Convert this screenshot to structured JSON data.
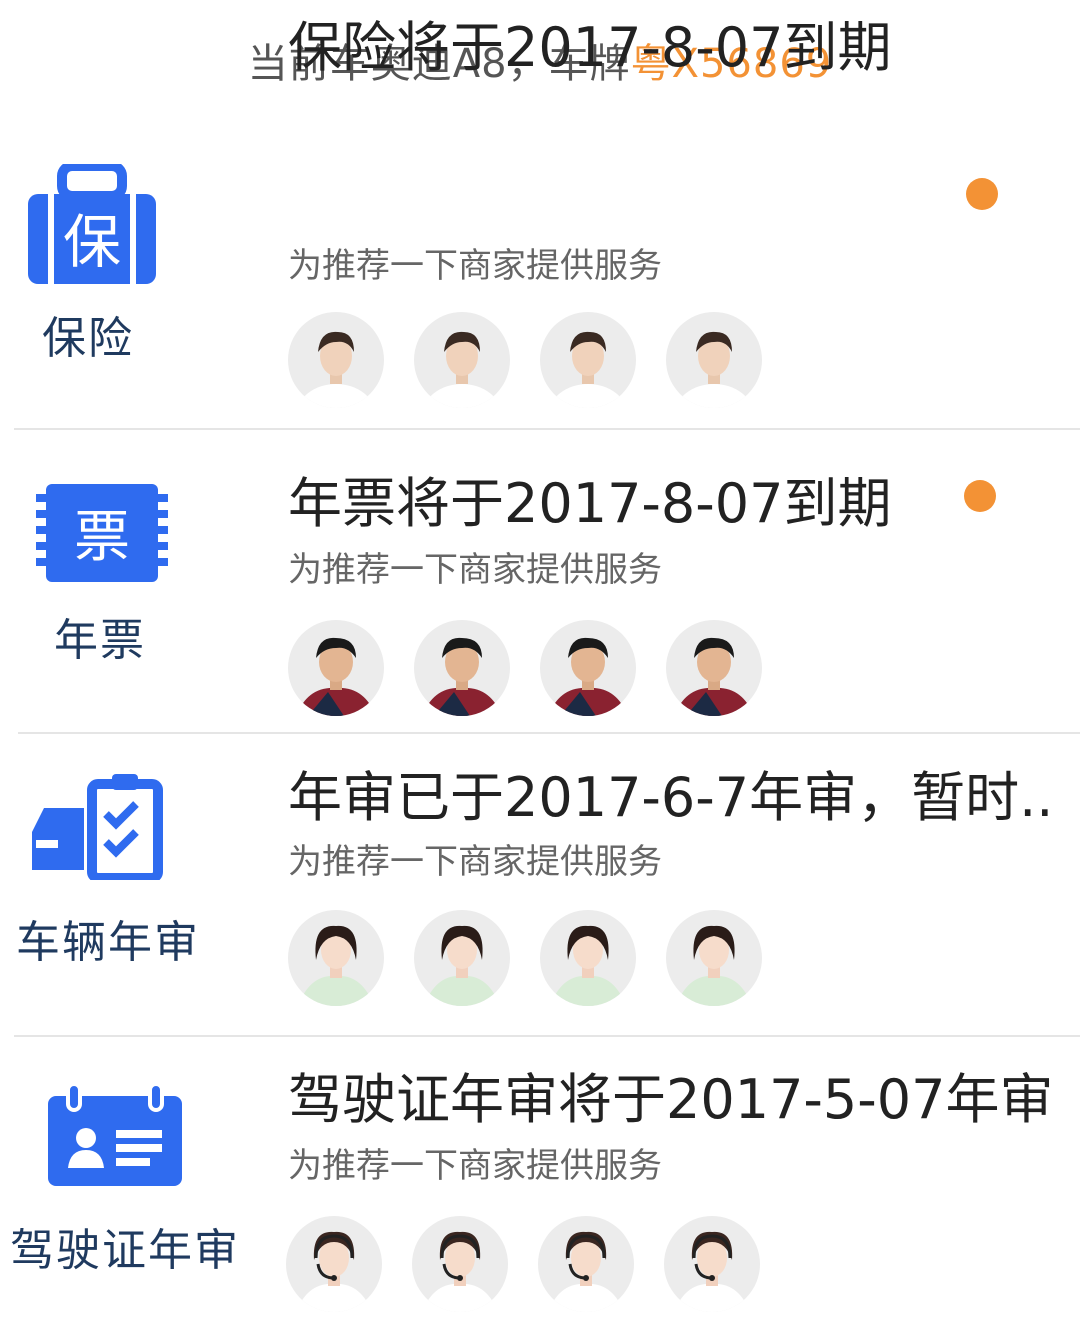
{
  "header": {
    "prefix": "当前车奥迪A8，车牌",
    "plate": "粤X56869"
  },
  "colors": {
    "accent_orange": "#F39235",
    "icon_blue": "#2F6BEF",
    "label_navy": "#1f3a5f"
  },
  "cards": [
    {
      "icon": "insurance-icon",
      "icon_char": "保",
      "category": "保险",
      "title": "保险将于2017-8-07到期",
      "subtitle": "为推荐一下商家提供服务",
      "has_dot": true,
      "avatar": "male-agent-avatar"
    },
    {
      "icon": "annual-ticket-icon",
      "icon_char": "票",
      "category": "年票",
      "title": "年票将于2017-8-07到期",
      "subtitle": "为推荐一下商家提供服务",
      "has_dot": true,
      "avatar": "male-agent-avatar"
    },
    {
      "icon": "vehicle-inspection-icon",
      "category": "车辆年审",
      "title": "年审已于2017-6-7年审，暂时..",
      "subtitle": "为推荐一下商家提供服务",
      "has_dot": false,
      "avatar": "female-agent-avatar"
    },
    {
      "icon": "license-card-icon",
      "category": "驾驶证年审",
      "title": "驾驶证年审将于2017-5-07年审",
      "subtitle": "为推荐一下商家提供服务",
      "has_dot": false,
      "avatar": "headset-agent-avatar"
    }
  ]
}
